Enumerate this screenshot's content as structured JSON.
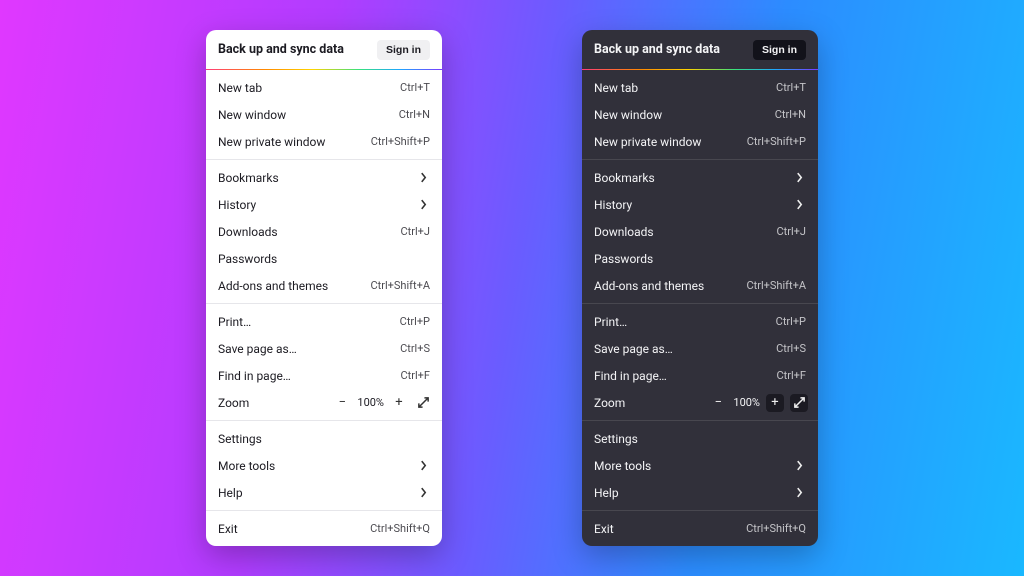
{
  "header": {
    "title": "Back up and sync data",
    "signin": "Sign in"
  },
  "items": {
    "new_tab": {
      "label": "New tab",
      "shortcut": "Ctrl+T"
    },
    "new_window": {
      "label": "New window",
      "shortcut": "Ctrl+N"
    },
    "new_private": {
      "label": "New private window",
      "shortcut": "Ctrl+Shift+P"
    },
    "bookmarks": {
      "label": "Bookmarks"
    },
    "history": {
      "label": "History"
    },
    "downloads": {
      "label": "Downloads",
      "shortcut": "Ctrl+J"
    },
    "passwords": {
      "label": "Passwords"
    },
    "addons": {
      "label": "Add-ons and themes",
      "shortcut": "Ctrl+Shift+A"
    },
    "print": {
      "label": "Print…",
      "shortcut": "Ctrl+P"
    },
    "save_as": {
      "label": "Save page as…",
      "shortcut": "Ctrl+S"
    },
    "find": {
      "label": "Find in page…",
      "shortcut": "Ctrl+F"
    },
    "zoom": {
      "label": "Zoom",
      "level": "100%"
    },
    "settings": {
      "label": "Settings"
    },
    "more_tools": {
      "label": "More tools"
    },
    "help": {
      "label": "Help"
    },
    "exit": {
      "label": "Exit",
      "shortcut": "Ctrl+Shift+Q"
    }
  },
  "icons": {
    "minus": "−",
    "plus": "+"
  }
}
